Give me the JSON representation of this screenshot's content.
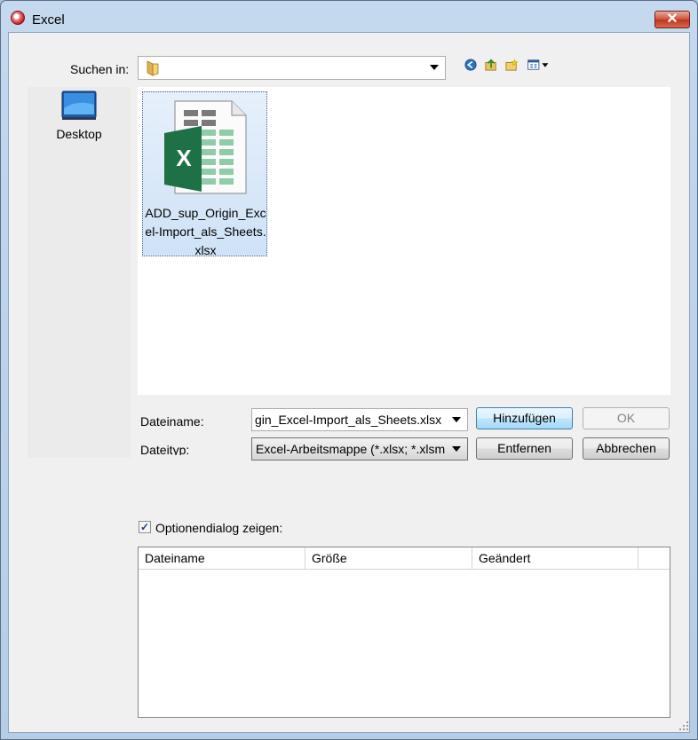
{
  "window": {
    "title": "Excel",
    "close_label": "✕"
  },
  "look_in": {
    "label": "Suchen in:",
    "value": ""
  },
  "places": [
    {
      "label": "Desktop"
    }
  ],
  "files": [
    {
      "name_lines": [
        "ADD_sup_Origin_Exc",
        "el-Import_als_Sheets.",
        "xlsx"
      ]
    }
  ],
  "filename": {
    "label": "Dateiname:",
    "value": "gin_Excel-Import_als_Sheets.xlsx"
  },
  "filetype": {
    "label": "Dateityp:",
    "value": "Excel-Arbeitsmappe (*.xlsx; *.xlsm"
  },
  "buttons": {
    "add": "Hinzufügen",
    "ok": "OK",
    "remove": "Entfernen",
    "cancel": "Abbrechen"
  },
  "options_checkbox": {
    "label": "Optionendialog zeigen:",
    "checked": true,
    "mark": "✓"
  },
  "table": {
    "columns": [
      "Dateiname",
      "Größe",
      "Geändert"
    ]
  },
  "colors": {
    "accent": "#3c7fb1",
    "excel_green": "#1e7145",
    "selection": "#cfe2f7"
  }
}
